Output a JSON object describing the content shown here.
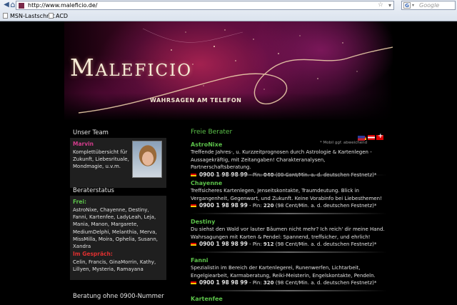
{
  "browser": {
    "url": "http://www.maleficio.de/",
    "search_placeholder": "Google",
    "search_icon_letter": "G",
    "nav_back": "◀",
    "nav_home": "⌂",
    "star": "☆",
    "dropdown": "▾",
    "bookmarks": [
      "MSN-Lastschrift",
      "ACD"
    ]
  },
  "header": {
    "logo": "Maleficio",
    "tagline": "WAHRSAGEN AM TELEFON"
  },
  "sidebar": {
    "team": {
      "title": "Unser Team",
      "name": "Marvin",
      "text": "Komplettübersicht für Zukunft, Liebesrituale, Mondmagie, u.v.m."
    },
    "status": {
      "title": "Beraterstatus",
      "free_label": "Frei:",
      "free_list": "AstroNixe, Chayenne, Destiny, Fanni, Kartenfee, LadyLeah, Leja, Mania, Manon, Margarete, MediumDelphi, Melanthia, Merva, MissMilla, Moira, Ophelia, Susann, Xandra",
      "busy_label": "Im Gespräch:",
      "busy_list": "Celin, Francis, GinaMorrin, Kathy, Lillyen, Mysteria, Ramayana"
    },
    "consult_title": "Beratung ohne 0900-Nummer"
  },
  "main": {
    "title": "Freie Berater",
    "mobile_note": "* Mobil ggf. abweichend",
    "berater": [
      {
        "name": "AstroNixe",
        "desc": "Treffende Jahres-, u. Kurzzeitprognosen durch Astrologie & Kartenlegen - Aussagekräftig, mit Zeitangaben! Charakteranalysen, Partnerschaftsberatung.",
        "phone": "0900 1 98 98 99",
        "pin_label": " - Pin: ",
        "pin": "040",
        "price": " (98 Cent/Min. a. d. deutschen Festnetz)*"
      },
      {
        "name": "Chayenne",
        "desc": "Treffsicheres Kartenlegen, Jenseitskontakte, Traumdeutung. Blick in Vergangenheit, Gegenwart, und Zukunft. Keine Vorabinfo bei Liebesthemen!",
        "phone": "0900 1 98 98 99",
        "pin_label": " - Pin: ",
        "pin": "220",
        "price": " (98 Cent/Min. a. d. deutschen Festnetz)*"
      },
      {
        "name": "Destiny",
        "desc": "Du siehst den Wald vor lauter Bäumen nicht mehr? Ich reich' dir meine Hand. Wahrsagungen mit Karten & Pendel: Spannend, treffsicher, und ehrlich!",
        "phone": "0900 1 98 98 99",
        "pin_label": " - Pin: ",
        "pin": "912",
        "price": " (98 Cent/Min. a. d. deutschen Festnetz)*"
      },
      {
        "name": "Fanni",
        "desc": "Spezialistin im Bereich der Kartenlegerei, Runenwerfen, Lichtarbeit, Engelgiearbeit, Karmaberatung, Reiki-Meisterin, Engelskontakte, Pendeln.",
        "phone": "0900 1 98 98 99",
        "pin_label": " - Pin: ",
        "pin": "320",
        "price": " (98 Cent/Min. a. d. deutschen Festnetz)*"
      },
      {
        "name": "Kartenfee"
      }
    ]
  },
  "colors": {
    "green": "#5cc24a",
    "pink": "#d33c8c",
    "red": "#e03030",
    "panel": "#1f1f1f"
  }
}
